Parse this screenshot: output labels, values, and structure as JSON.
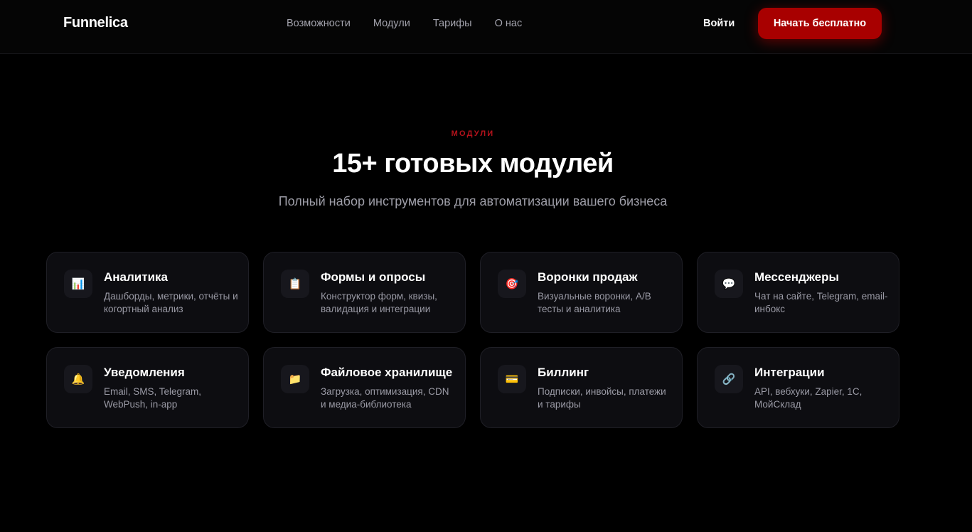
{
  "header": {
    "logo": "Funnelica",
    "nav": [
      "Возможности",
      "Модули",
      "Тарифы",
      "О нас"
    ],
    "login": "Войти",
    "cta": "Начать бесплатно"
  },
  "section": {
    "eyebrow": "МОДУЛИ",
    "title": "15+ готовых модулей",
    "subtitle": "Полный набор инструментов для автоматизации вашего бизнеса"
  },
  "modules": [
    {
      "icon": "chart-icon",
      "glyph": "📊",
      "title": "Аналитика",
      "desc": "Дашборды, метрики, отчёты и когортный анализ"
    },
    {
      "icon": "clipboard-icon",
      "glyph": "📋",
      "title": "Формы и опросы",
      "desc": "Конструктор форм, квизы, валидация и интеграции"
    },
    {
      "icon": "target-icon",
      "glyph": "🎯",
      "title": "Воронки продаж",
      "desc": "Визуальные воронки, A/B тесты и аналитика"
    },
    {
      "icon": "chat-bubble-icon",
      "glyph": "💬",
      "title": "Мессенджеры",
      "desc": "Чат на сайте, Telegram, email-инбокс"
    },
    {
      "icon": "bell-icon",
      "glyph": "🔔",
      "title": "Уведомления",
      "desc": "Email, SMS, Telegram, WebPush, in-app"
    },
    {
      "icon": "folder-icon",
      "glyph": "📁",
      "title": "Файловое хранилище",
      "desc": "Загрузка, оптимизация, CDN и медиа-библиотека"
    },
    {
      "icon": "credit-card-icon",
      "glyph": "💳",
      "title": "Биллинг",
      "desc": "Подписки, инвойсы, платежи и тарифы"
    },
    {
      "icon": "link-icon",
      "glyph": "🔗",
      "title": "Интеграции",
      "desc": "API, вебхуки, Zapier, 1С, МойСклад"
    }
  ],
  "colors": {
    "accent": "#a80000",
    "eyebrow": "#b3121b",
    "background": "#000000",
    "card": "#0d0d11"
  }
}
